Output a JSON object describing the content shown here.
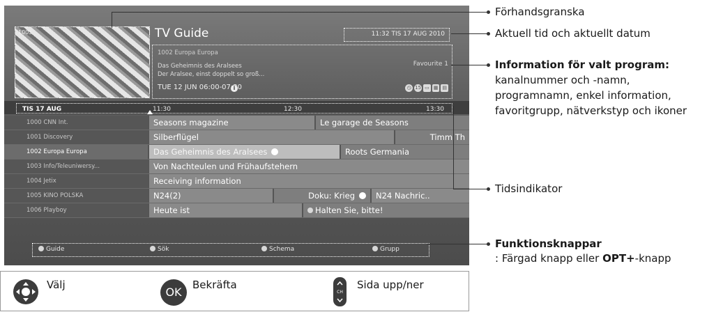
{
  "tv": {
    "title": "TV Guide",
    "clock": "11:32  TIS 17 AUG 2010",
    "preview_channel": "1005",
    "info": {
      "channel": "1002  Europa Europa",
      "program": "Das Geheimnis des Aralsees",
      "description": "Der Aralsee, einst doppelt so groß...",
      "time": "TUE 12 JUN  06:00-07:30",
      "info_icon": "i",
      "favourite": "Favourite 1",
      "icons": [
        "clock-icon",
        "age-15-icon",
        "network-icon",
        "hd-icon",
        "lock-icon"
      ],
      "age_label": "15"
    },
    "date_bar": {
      "date": "TIS 17 AUG",
      "t1": "11:30",
      "t2": "12:30",
      "t3": "13:30"
    },
    "channels": [
      {
        "name": "1000  CNN Int.",
        "programs": [
          "Seasons magazine",
          "Le garage de Seasons"
        ]
      },
      {
        "name": "1001  Discovery",
        "programs": [
          "Silberflügel",
          "Timm Th"
        ]
      },
      {
        "name": "1002  Europa Europa",
        "programs": [
          "Das Geheimnis des Aralsees",
          "Roots Germania"
        ]
      },
      {
        "name": "1003  Info/Teleuniwersy...",
        "programs": [
          "Von Nachteulen und Frühaufstehern"
        ]
      },
      {
        "name": "1004  Jetix",
        "programs": [
          "Receiving information"
        ]
      },
      {
        "name": "1005  KINO POLSKA",
        "programs": [
          "N24(2)",
          "Doku: Krieg",
          "N24 Nachric.."
        ]
      },
      {
        "name": "1006  Playboy",
        "programs": [
          "Heute ist",
          "Halten Sie, bitte!"
        ]
      }
    ],
    "function_keys": [
      "Guide",
      "Sök",
      "Schema",
      "Grupp"
    ]
  },
  "annotations": {
    "preview": "Förhandsgranska",
    "clock": "Aktuell tid och aktuellt datum",
    "info_title": "Information för valt program:",
    "info_lines": [
      "kanalnummer och -namn,",
      "programnamn, enkel information,",
      "favoritgrupp, nätverkstyp och ikoner"
    ],
    "time_indicator": "Tidsindikator",
    "fkeys_title": "Funktionsknappar",
    "fkeys_sub_prefix": ": Färgad knapp eller ",
    "fkeys_sub_bold": "OPT+",
    "fkeys_sub_suffix": "-knapp"
  },
  "legend": {
    "select": "Välj",
    "ok_icon": "OK",
    "confirm": "Bekräfta",
    "ch_label": "CH",
    "page": "Sida upp/ner"
  },
  "colors": {
    "tv_bg": "#5f5f5f",
    "highlight": "#bdbdbd",
    "annotation": "#333333"
  }
}
